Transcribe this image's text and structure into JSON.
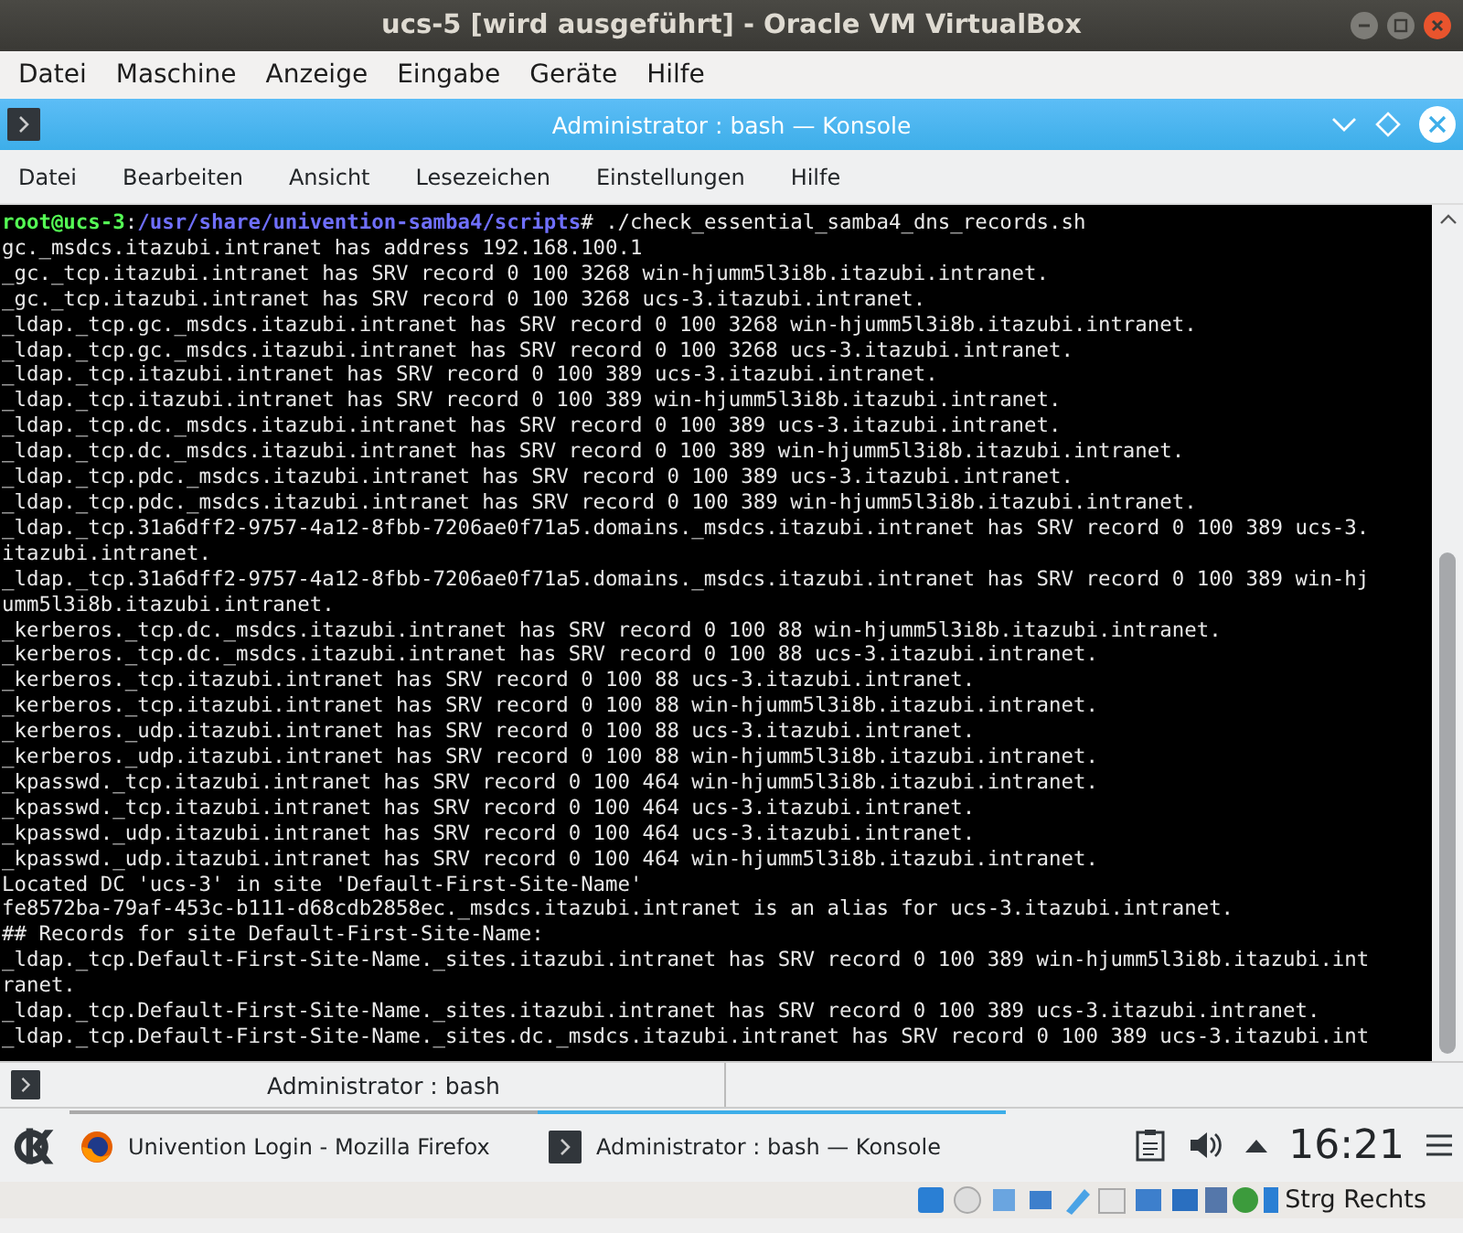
{
  "vm_window": {
    "title": "ucs-5 [wird ausgeführt] - Oracle VM VirtualBox",
    "menu": [
      "Datei",
      "Maschine",
      "Anzeige",
      "Eingabe",
      "Geräte",
      "Hilfe"
    ]
  },
  "konsole": {
    "title": "Administrator : bash — Konsole",
    "menu": [
      "Datei",
      "Bearbeiten",
      "Ansicht",
      "Lesezeichen",
      "Einstellungen",
      "Hilfe"
    ],
    "terminal": {
      "prompt": {
        "user": "root@ucs-3",
        "separator": ":",
        "path": "/usr/share/univention-samba4/scripts",
        "command": "# ./check_essential_samba4_dns_records.sh"
      },
      "lines": [
        "gc._msdcs.itazubi.intranet has address 192.168.100.1",
        "_gc._tcp.itazubi.intranet has SRV record 0 100 3268 win-hjumm5l3i8b.itazubi.intranet.",
        "_gc._tcp.itazubi.intranet has SRV record 0 100 3268 ucs-3.itazubi.intranet.",
        "_ldap._tcp.gc._msdcs.itazubi.intranet has SRV record 0 100 3268 win-hjumm5l3i8b.itazubi.intranet.",
        "_ldap._tcp.gc._msdcs.itazubi.intranet has SRV record 0 100 3268 ucs-3.itazubi.intranet.",
        "_ldap._tcp.itazubi.intranet has SRV record 0 100 389 ucs-3.itazubi.intranet.",
        "_ldap._tcp.itazubi.intranet has SRV record 0 100 389 win-hjumm5l3i8b.itazubi.intranet.",
        "_ldap._tcp.dc._msdcs.itazubi.intranet has SRV record 0 100 389 ucs-3.itazubi.intranet.",
        "_ldap._tcp.dc._msdcs.itazubi.intranet has SRV record 0 100 389 win-hjumm5l3i8b.itazubi.intranet.",
        "_ldap._tcp.pdc._msdcs.itazubi.intranet has SRV record 0 100 389 ucs-3.itazubi.intranet.",
        "_ldap._tcp.pdc._msdcs.itazubi.intranet has SRV record 0 100 389 win-hjumm5l3i8b.itazubi.intranet.",
        "_ldap._tcp.31a6dff2-9757-4a12-8fbb-7206ae0f71a5.domains._msdcs.itazubi.intranet has SRV record 0 100 389 ucs-3.",
        "itazubi.intranet.",
        "_ldap._tcp.31a6dff2-9757-4a12-8fbb-7206ae0f71a5.domains._msdcs.itazubi.intranet has SRV record 0 100 389 win-hj",
        "umm5l3i8b.itazubi.intranet.",
        "_kerberos._tcp.dc._msdcs.itazubi.intranet has SRV record 0 100 88 win-hjumm5l3i8b.itazubi.intranet.",
        "_kerberos._tcp.dc._msdcs.itazubi.intranet has SRV record 0 100 88 ucs-3.itazubi.intranet.",
        "_kerberos._tcp.itazubi.intranet has SRV record 0 100 88 ucs-3.itazubi.intranet.",
        "_kerberos._tcp.itazubi.intranet has SRV record 0 100 88 win-hjumm5l3i8b.itazubi.intranet.",
        "_kerberos._udp.itazubi.intranet has SRV record 0 100 88 ucs-3.itazubi.intranet.",
        "_kerberos._udp.itazubi.intranet has SRV record 0 100 88 win-hjumm5l3i8b.itazubi.intranet.",
        "_kpasswd._tcp.itazubi.intranet has SRV record 0 100 464 win-hjumm5l3i8b.itazubi.intranet.",
        "_kpasswd._tcp.itazubi.intranet has SRV record 0 100 464 ucs-3.itazubi.intranet.",
        "_kpasswd._udp.itazubi.intranet has SRV record 0 100 464 ucs-3.itazubi.intranet.",
        "_kpasswd._udp.itazubi.intranet has SRV record 0 100 464 win-hjumm5l3i8b.itazubi.intranet.",
        "Located DC 'ucs-3' in site 'Default-First-Site-Name'",
        "fe8572ba-79af-453c-b111-d68cdb2858ec._msdcs.itazubi.intranet is an alias for ucs-3.itazubi.intranet.",
        "## Records for site Default-First-Site-Name:",
        "_ldap._tcp.Default-First-Site-Name._sites.itazubi.intranet has SRV record 0 100 389 win-hjumm5l3i8b.itazubi.int",
        "ranet.",
        "_ldap._tcp.Default-First-Site-Name._sites.itazubi.intranet has SRV record 0 100 389 ucs-3.itazubi.intranet.",
        "_ldap._tcp.Default-First-Site-Name._sites.dc._msdcs.itazubi.intranet has SRV record 0 100 389 ucs-3.itazubi.int"
      ]
    },
    "tabs": [
      {
        "label": "Administrator : bash"
      }
    ]
  },
  "taskbar": {
    "tasks": [
      {
        "kind": "firefox",
        "label": "Univention Login - Mozilla Firefox",
        "selected": false
      },
      {
        "kind": "konsole",
        "label": "Administrator : bash — Konsole",
        "selected": true
      }
    ],
    "clock": "16:21"
  },
  "status_bar": {
    "host_key": "Strg Rechts"
  }
}
